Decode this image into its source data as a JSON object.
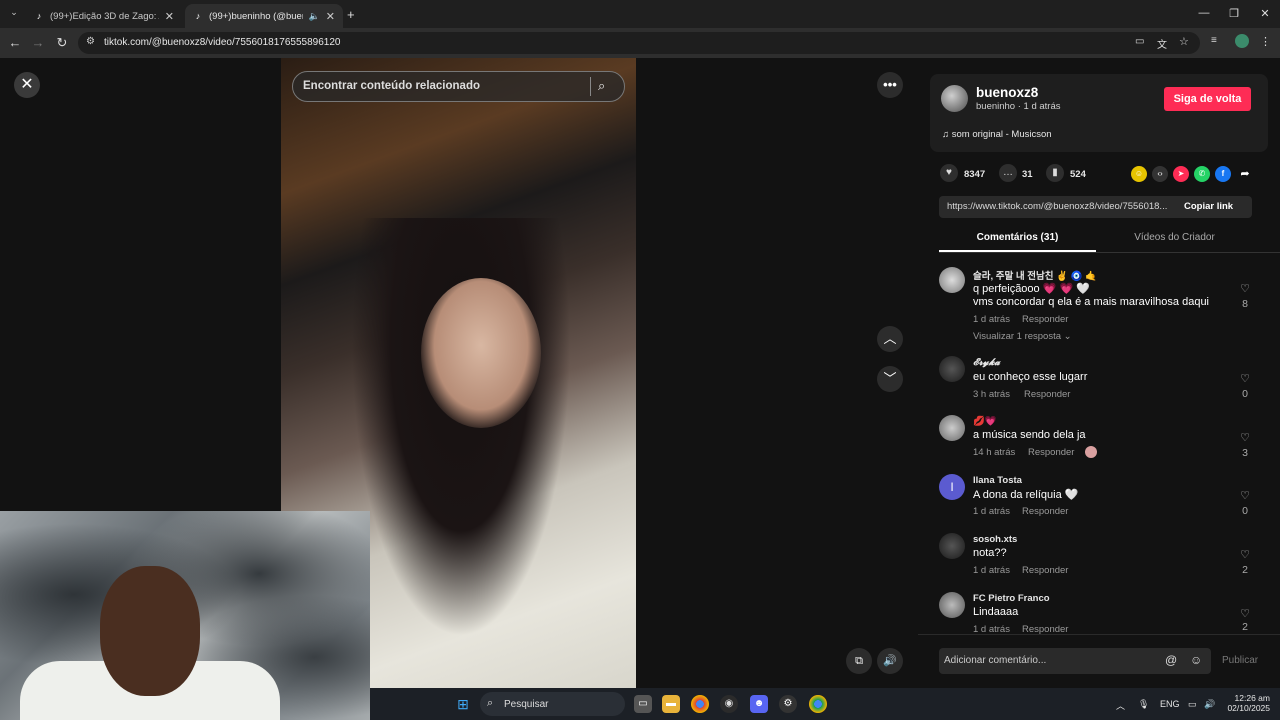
{
  "browser": {
    "tabs": [
      {
        "title": "(99+)Edição 3D de Zago: A Me",
        "active": false
      },
      {
        "title": "(99+)bueninho (@buenoxz",
        "active": true
      }
    ],
    "url": "tiktok.com/@buenoxz8/video/7556018176555896120"
  },
  "video": {
    "search_placeholder": "Encontrar conteúdo relacionado"
  },
  "post": {
    "username": "buenoxz8",
    "subtitle": "bueninho · 1 d atrás",
    "follow_label": "Siga de volta",
    "music": "som original - Musicson",
    "likes": "8347",
    "comments": "31",
    "saves": "524",
    "link": "https://www.tiktok.com/@buenoxz8/video/7556018...",
    "copy_label": "Copiar link",
    "tab_comments": "Comentários (31)",
    "tab_creator": "Vídeos do Criador"
  },
  "comments": [
    {
      "user": "슬라, 주말 내 전남친 ✌ 🧿 🤙",
      "text1": "q perfeiçãooo 💗 💗 🤍",
      "text2": "vms concordar q ela é a mais maravilhosa daqui",
      "time": "1 d atrás",
      "reply": "Responder",
      "likes": "8",
      "view_replies": "Visualizar 1 resposta"
    },
    {
      "user": "𝓔𝓻𝔂𝓴𝓪",
      "text1": "eu conheço esse lugarr",
      "time": "3 h atrás",
      "reply": "Responder",
      "likes": "0"
    },
    {
      "user": "💋💗",
      "text1": "a música sendo dela ja",
      "time": "14 h atrás",
      "reply": "Responder",
      "likes": "3"
    },
    {
      "user": "Ilana Tosta",
      "avatar_letter": "I",
      "text1": "A dona da relíquia 🤍",
      "time": "1 d atrás",
      "reply": "Responder",
      "likes": "0"
    },
    {
      "user": "sosoh.xts",
      "text1": "nota??",
      "time": "1 d atrás",
      "reply": "Responder",
      "likes": "2"
    },
    {
      "user": "FC Pietro Franco",
      "text1": "Lindaaaa",
      "time": "1 d atrás",
      "reply": "Responder",
      "likes": "2"
    }
  ],
  "composer": {
    "placeholder": "Adicionar comentário...",
    "publish": "Publicar"
  },
  "taskbar": {
    "search": "Pesquisar",
    "lang": "ENG",
    "time": "12:26 am",
    "date": "02/10/2025"
  },
  "colors": {
    "accent": "#fe2c55",
    "panel": "#121212"
  }
}
